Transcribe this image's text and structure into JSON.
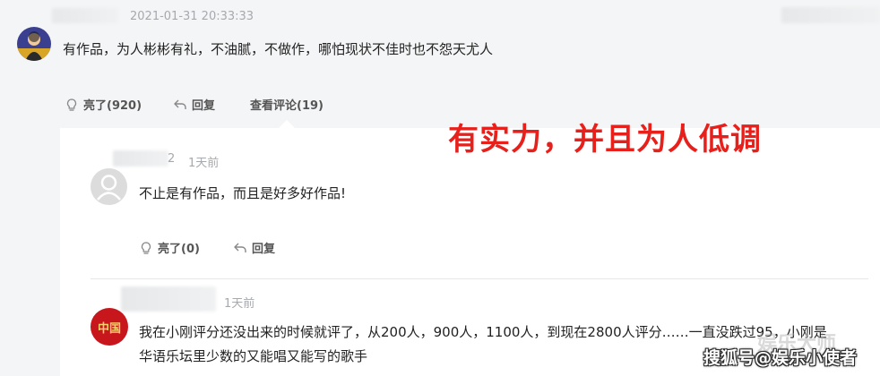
{
  "comment": {
    "timestamp": "2021-01-31 20:33:33",
    "text": "有作品，为人彬彬有礼，不油腻，不做作，哪怕现状不佳时也不怨天尤人",
    "like_label": "亮了(920)",
    "reply_label": "回复",
    "view_replies_label": "查看评论(19)"
  },
  "overlay": {
    "caption": "有实力，并且为人低调",
    "color": "#e8201c"
  },
  "replies": [
    {
      "username_tail": "2",
      "time": "1天前",
      "text": "不止是有作品，而且是好多好作品!",
      "like_label": "亮了(0)",
      "reply_label": "回复"
    },
    {
      "time": "1天前",
      "text_line1": "我在小刚评分还没出来的时候就评了，从200人，900人，1100人，到现在2800人评分……一直没跌过95，小刚是",
      "text_line2": "华语乐坛里少数的又能唱又能写的歌手",
      "avatar_text": "中国"
    }
  ],
  "watermarks": {
    "source": "搜狐号@娱乐小使者",
    "faint": "娱乐大师"
  }
}
